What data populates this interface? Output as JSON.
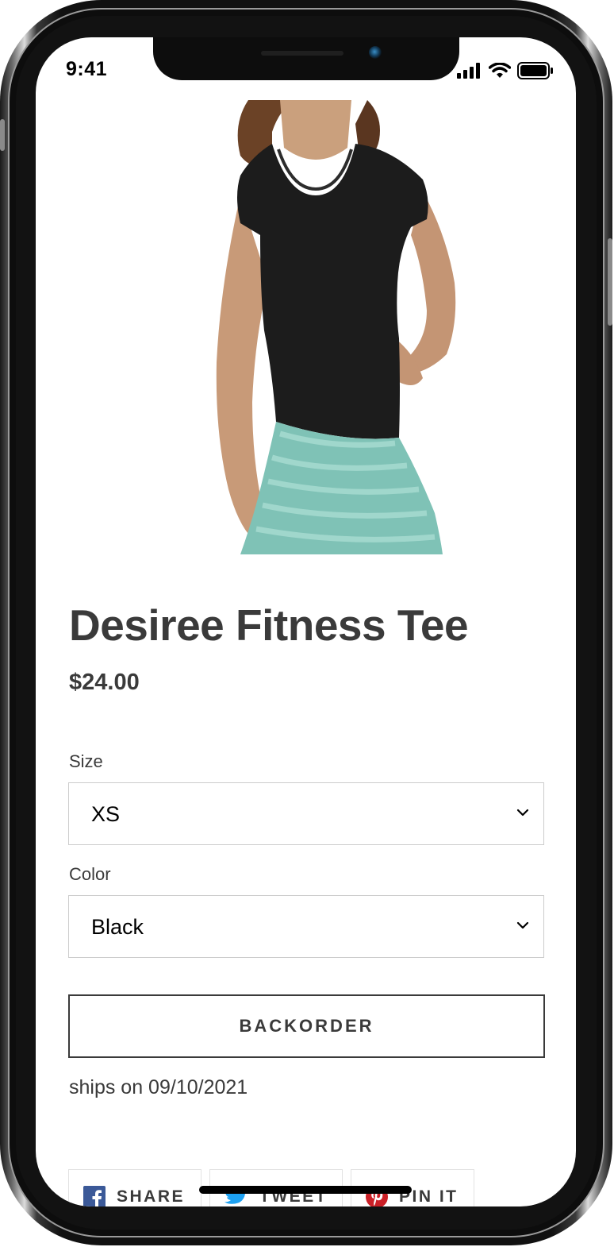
{
  "status_bar": {
    "time": "9:41"
  },
  "product": {
    "title": "Desiree Fitness Tee",
    "price": "$24.00",
    "image_alt": "woman wearing black fitted tee and teal leggings"
  },
  "options": {
    "size": {
      "label": "Size",
      "value": "XS"
    },
    "color": {
      "label": "Color",
      "value": "Black"
    }
  },
  "actions": {
    "backorder_label": "BACKORDER",
    "ships_text": "ships on 09/10/2021"
  },
  "share": {
    "facebook_label": "SHARE",
    "twitter_label": "TWEET",
    "pinterest_label": "PIN IT"
  },
  "colors": {
    "text": "#3a3a3a",
    "facebook": "#3b5998",
    "twitter": "#1da1f2",
    "pinterest": "#cb2027"
  }
}
